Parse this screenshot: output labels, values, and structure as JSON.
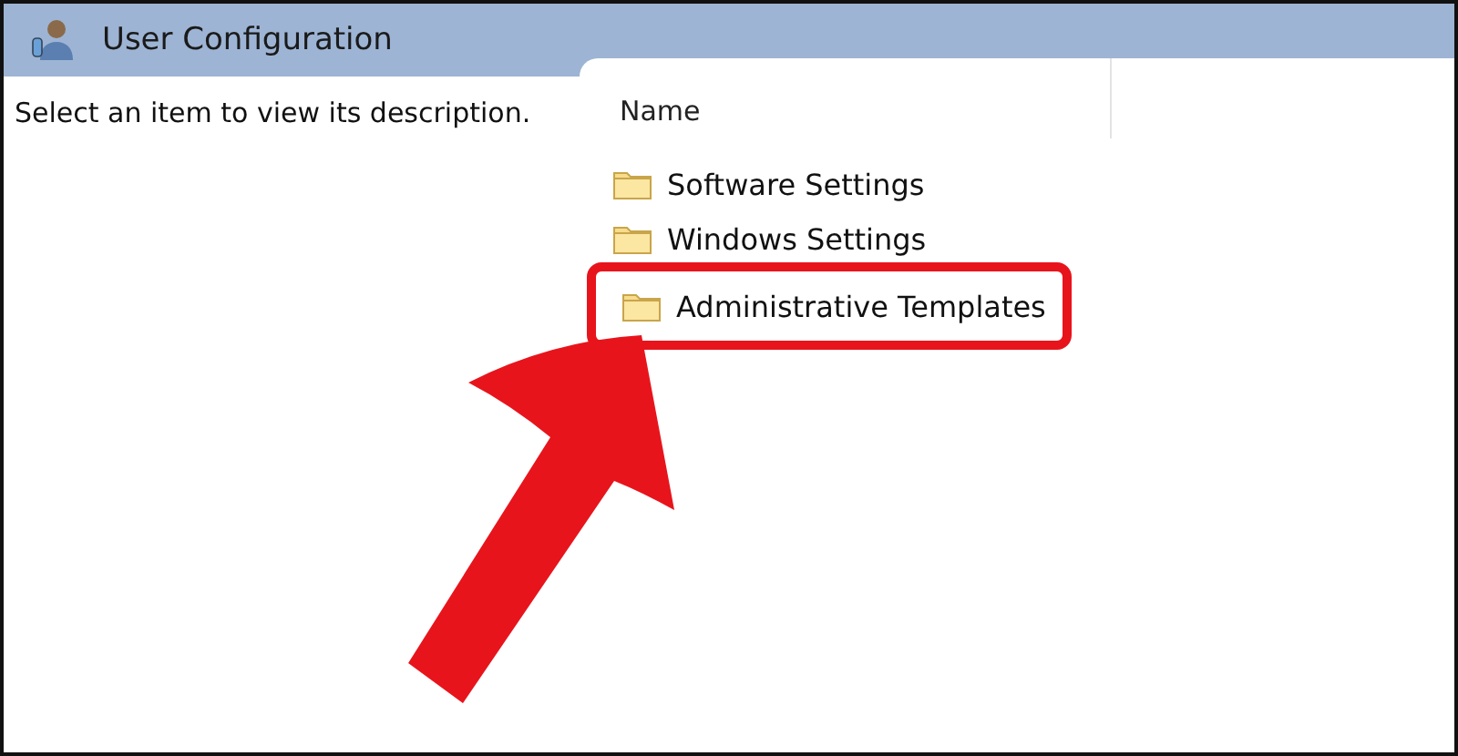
{
  "header": {
    "title": "User Configuration"
  },
  "description": "Select an item to view its description.",
  "table": {
    "columns": [
      "Name"
    ],
    "rows": [
      {
        "name": "Software Settings",
        "highlighted": false
      },
      {
        "name": "Windows Settings",
        "highlighted": false
      },
      {
        "name": "Administrative Templates",
        "highlighted": true
      }
    ]
  }
}
